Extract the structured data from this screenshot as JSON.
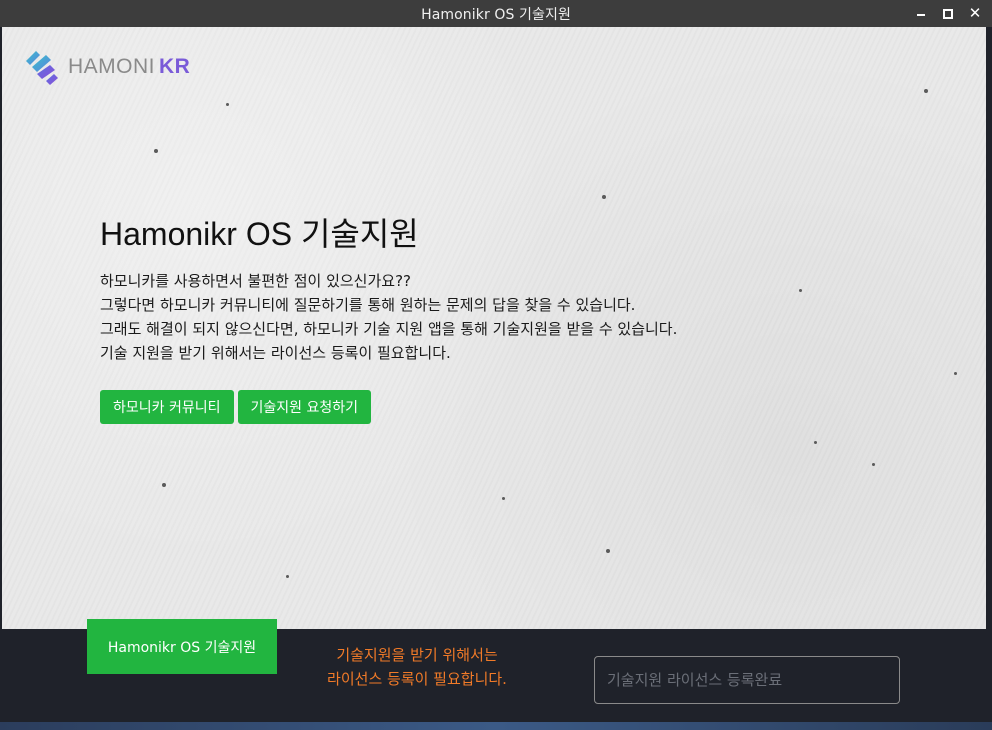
{
  "window": {
    "title": "Hamonikr OS 기술지원",
    "controls": [
      "minimize-icon",
      "maximize-icon",
      "close-icon"
    ],
    "close_glyph": "✕"
  },
  "logo": {
    "text_main": "HAMONI",
    "text_accent": "KR",
    "accent_color": "#7a5bd8"
  },
  "hero": {
    "title": "Hamonikr OS 기술지원",
    "lines": [
      "하모니카를 사용하면서 불편한 점이 있으신가요??",
      "그렇다면 하모니카 커뮤니티에 질문하기를 통해 원하는 문제의 답을 찾을 수 있습니다.",
      "그래도 해결이 되지 않으신다면, 하모니카 기술 지원 앱을 통해 기술지원을 받을 수 있습니다.",
      "기술 지원을 받기 위해서는 라이선스 등록이 필요합니다."
    ],
    "buttons": {
      "community": "하모니카 커뮤니티",
      "request": "기술지원 요청하기"
    }
  },
  "bottom": {
    "tab_label": "Hamonikr OS 기술지원",
    "message_line1": "기술지원을 받기 위해서는",
    "message_line2": "라이선스 등록이 필요합니다.",
    "license_placeholder": "기술지원 라이선스 등록완료"
  },
  "colors": {
    "green": "#22b540",
    "orange": "#f07a28",
    "dark": "#1f222a",
    "titlebar": "#3d3d3d"
  }
}
